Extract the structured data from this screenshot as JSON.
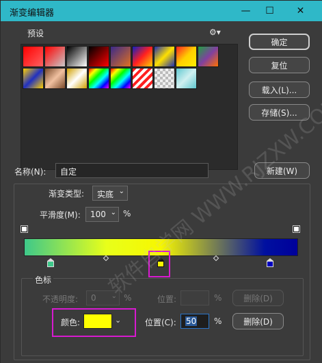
{
  "window": {
    "title": "渐变编辑器",
    "min_icon": "minimize-icon",
    "max_icon": "maximize-icon",
    "close_icon": "close-icon"
  },
  "presets": {
    "label": "预设",
    "gear_icon": "gear-icon",
    "gear_glyph": "⚙▾"
  },
  "buttons": {
    "ok": "确定",
    "reset": "复位",
    "load": "载入(L)...",
    "save": "存储(S)...",
    "new": "新建(W)"
  },
  "name": {
    "label": "名称(N):",
    "value": "自定"
  },
  "gradient_type": {
    "label": "渐变类型:",
    "value": "实底"
  },
  "smoothness": {
    "label": "平滑度(M):",
    "value": "100",
    "unit": "%"
  },
  "gradient": {
    "colors": [
      "#3ec88a",
      "#e8ff1a",
      "#f7f700",
      "#0010a0",
      "#00009a"
    ],
    "stop_colors": [
      "#3ec88a",
      "#f7f700",
      "#0000c0"
    ]
  },
  "color_stops": {
    "section_label": "色标",
    "opacity_label": "不透明度:",
    "opacity_value": "0",
    "opacity_unit": "%",
    "opacity_position_label": "位置:",
    "opacity_position_unit": "%",
    "opacity_delete": "删除(D)",
    "color_label": "颜色:",
    "color_value": "#ffff00",
    "position_label": "位置(C):",
    "position_value": "50",
    "position_unit": "%",
    "delete": "删除(D)"
  },
  "watermark": "软件自学网 WWW.RJZXW.COM",
  "highlight_color": "#d81ad0"
}
